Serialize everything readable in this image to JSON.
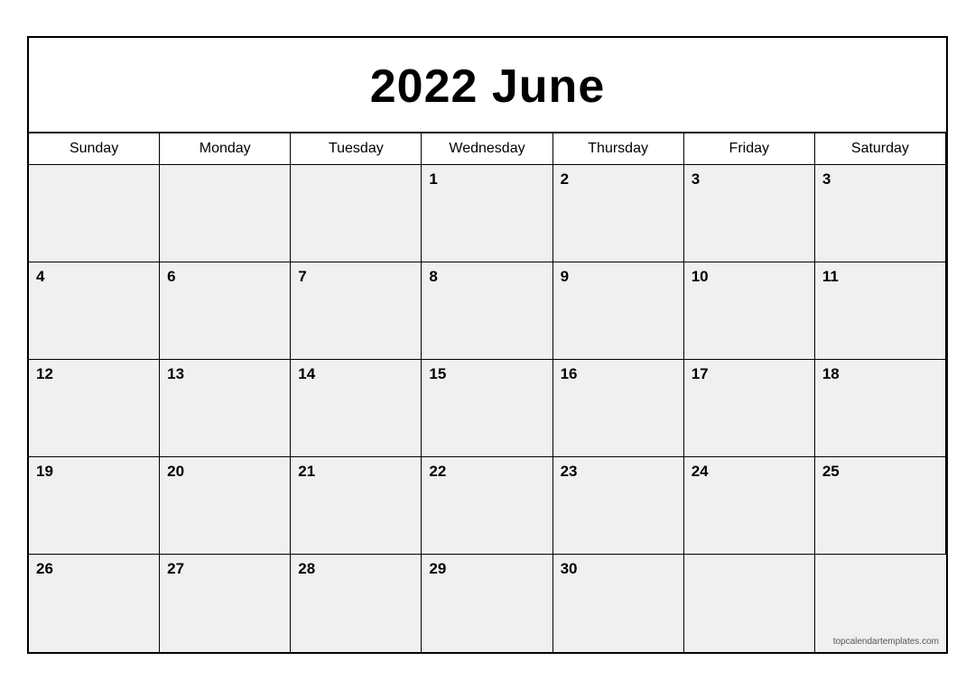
{
  "calendar": {
    "title": "2022 June",
    "year": "2022",
    "month": "June",
    "watermark": "topcalendartemplates.com",
    "headers": [
      "Sunday",
      "Monday",
      "Tuesday",
      "Wednesday",
      "Thursday",
      "Friday",
      "Saturday"
    ],
    "weeks": [
      [
        {
          "day": "",
          "empty": true
        },
        {
          "day": "",
          "empty": true
        },
        {
          "day": "",
          "empty": true
        },
        {
          "day": "1",
          "empty": false
        },
        {
          "day": "2",
          "empty": false
        },
        {
          "day": "3",
          "empty": false
        },
        {
          "day": "3",
          "empty": false
        }
      ],
      [
        {
          "day": "4",
          "empty": false
        },
        {
          "day": "6",
          "empty": false
        },
        {
          "day": "7",
          "empty": false
        },
        {
          "day": "8",
          "empty": false
        },
        {
          "day": "9",
          "empty": false
        },
        {
          "day": "10",
          "empty": false
        },
        {
          "day": "11",
          "empty": false
        }
      ],
      [
        {
          "day": "12",
          "empty": false
        },
        {
          "day": "13",
          "empty": false
        },
        {
          "day": "14",
          "empty": false
        },
        {
          "day": "15",
          "empty": false
        },
        {
          "day": "16",
          "empty": false
        },
        {
          "day": "17",
          "empty": false
        },
        {
          "day": "18",
          "empty": false
        }
      ],
      [
        {
          "day": "19",
          "empty": false
        },
        {
          "day": "20",
          "empty": false
        },
        {
          "day": "21",
          "empty": false
        },
        {
          "day": "22",
          "empty": false
        },
        {
          "day": "23",
          "empty": false
        },
        {
          "day": "24",
          "empty": false
        },
        {
          "day": "25",
          "empty": false
        }
      ],
      [
        {
          "day": "26",
          "empty": false
        },
        {
          "day": "27",
          "empty": false
        },
        {
          "day": "28",
          "empty": false
        },
        {
          "day": "29",
          "empty": false
        },
        {
          "day": "30",
          "empty": false
        },
        {
          "day": "",
          "empty": true
        },
        {
          "day": "",
          "empty": true,
          "watermark": true
        }
      ]
    ]
  }
}
